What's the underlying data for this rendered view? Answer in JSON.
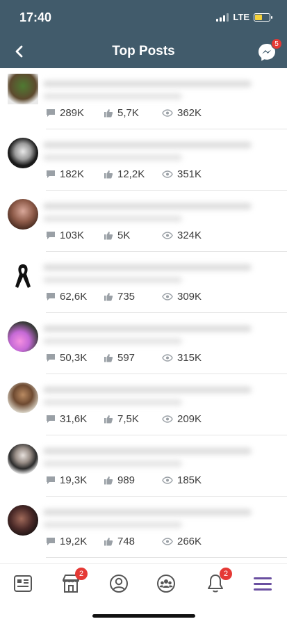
{
  "status_bar": {
    "time": "17:40",
    "network": "LTE"
  },
  "header": {
    "title": "Top Posts",
    "messenger_badge": "5"
  },
  "posts": [
    {
      "comments": "289K",
      "likes": "5,7K",
      "views": "362K"
    },
    {
      "comments": "182K",
      "likes": "12,2K",
      "views": "351K"
    },
    {
      "comments": "103K",
      "likes": "5K",
      "views": "324K"
    },
    {
      "comments": "62,6K",
      "likes": "735",
      "views": "309K"
    },
    {
      "comments": "50,3K",
      "likes": "597",
      "views": "315K"
    },
    {
      "comments": "31,6K",
      "likes": "7,5K",
      "views": "209K"
    },
    {
      "comments": "19,3K",
      "likes": "989",
      "views": "185K"
    },
    {
      "comments": "19,2K",
      "likes": "748",
      "views": "266K"
    }
  ],
  "tabbar": {
    "items": [
      {
        "icon": "news-feed-icon"
      },
      {
        "icon": "shop-icon",
        "badge": "2"
      },
      {
        "icon": "profile-icon"
      },
      {
        "icon": "groups-icon"
      },
      {
        "icon": "notifications-icon",
        "badge": "2"
      },
      {
        "icon": "menu-icon"
      }
    ]
  },
  "colors": {
    "header_bg": "#415b6b",
    "badge": "#e53935",
    "accent": "#6a4fa0"
  }
}
